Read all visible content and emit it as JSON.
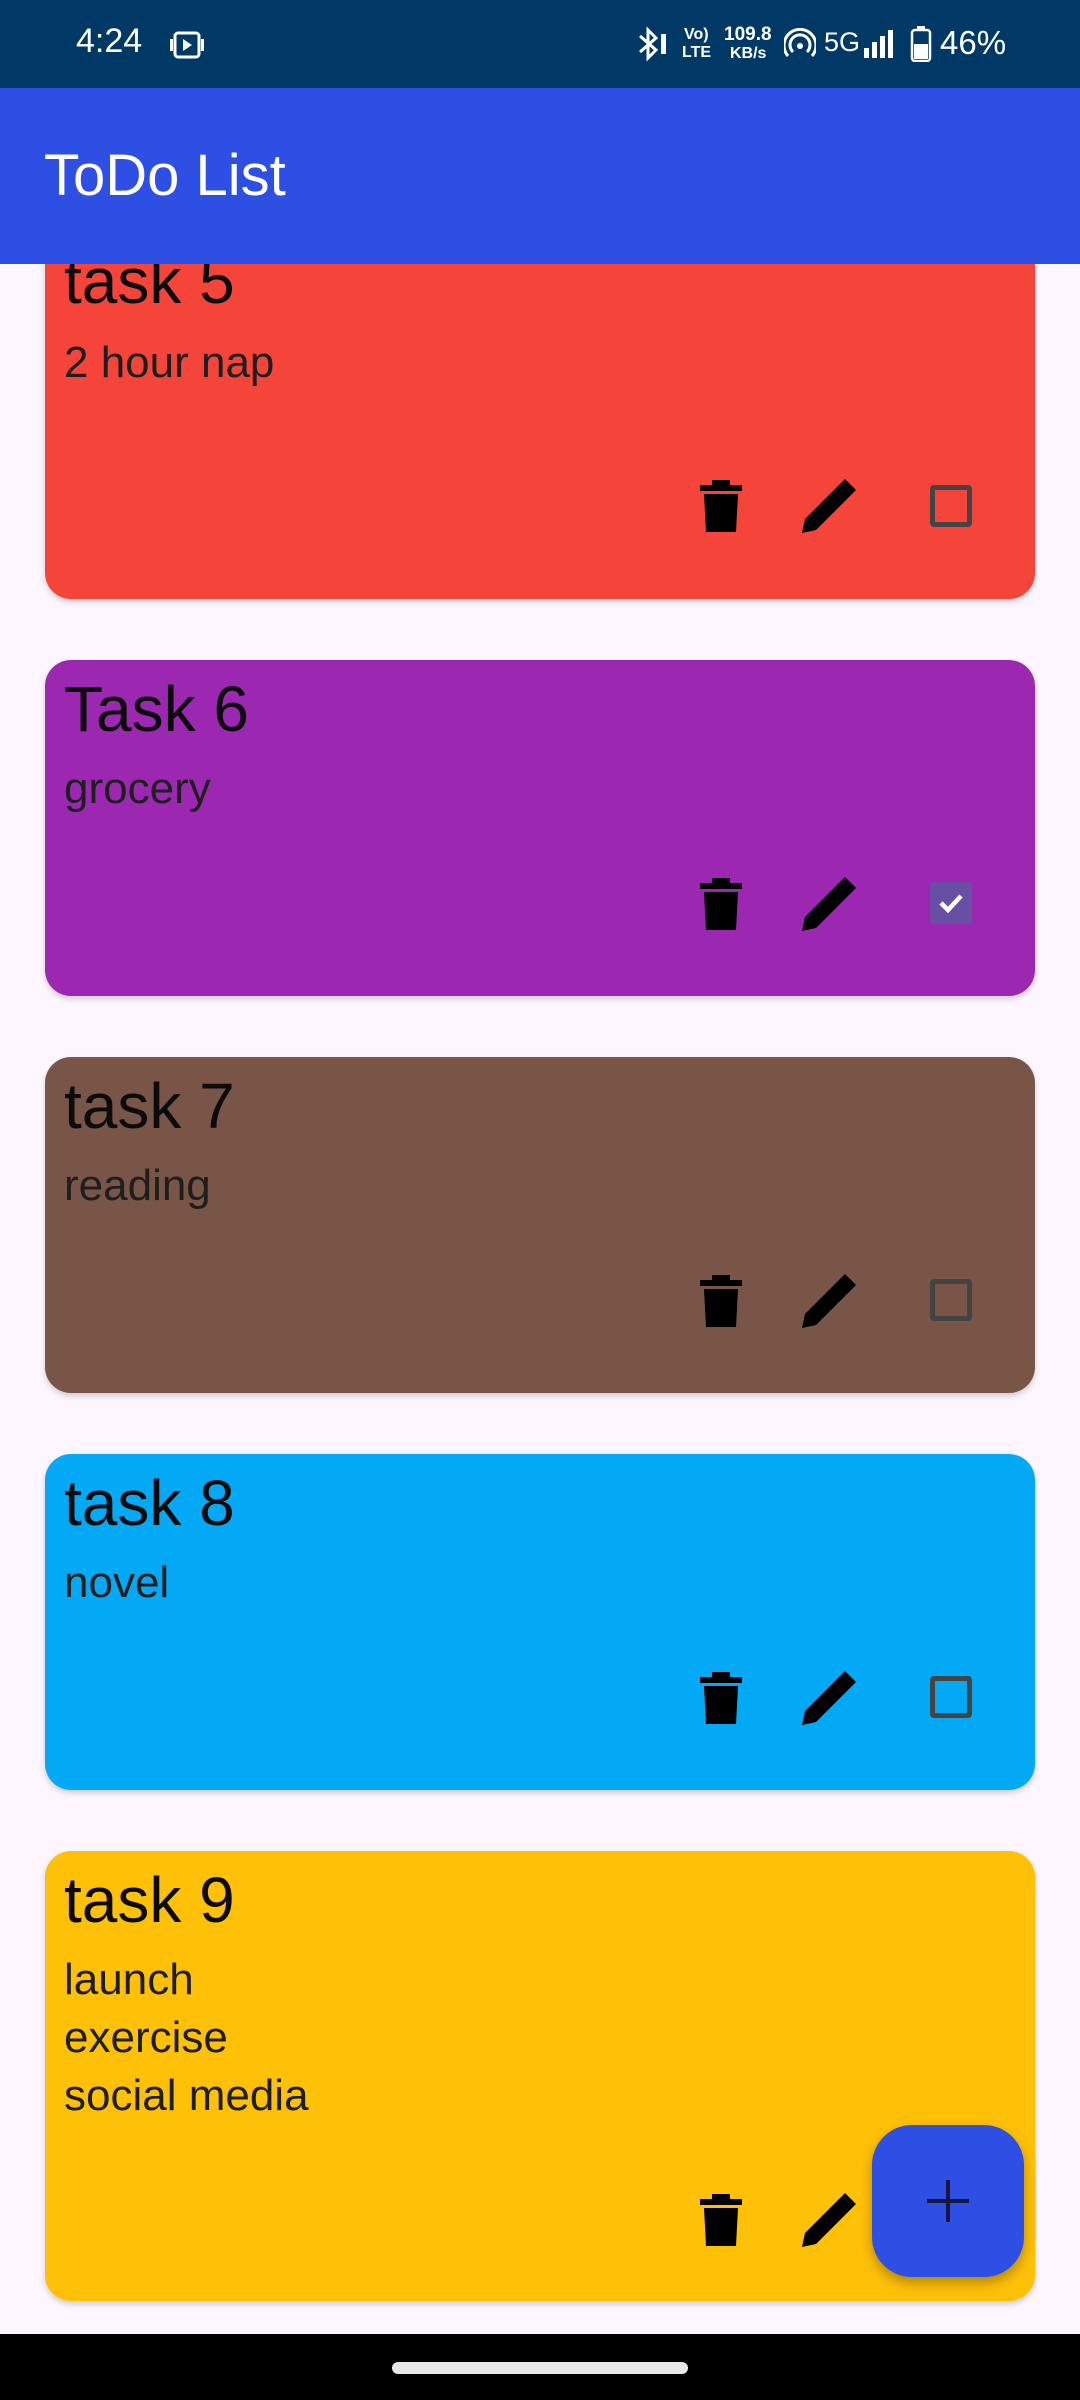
{
  "status_bar": {
    "time": "4:24",
    "net_top": "Vo)",
    "net_bottom": "LTE",
    "speed_value": "109.8",
    "speed_unit": "KB/s",
    "network": "5G",
    "battery": "46%"
  },
  "app_bar": {
    "title": "ToDo List"
  },
  "tasks": [
    {
      "title": "task 5",
      "description": " 2 hour nap",
      "color": "#f5453a",
      "done": false
    },
    {
      "title": "Task 6",
      "description": "grocery",
      "color": "#9c28b1",
      "done": true
    },
    {
      "title": "task 7",
      "description": "reading",
      "color": "#795548",
      "done": false
    },
    {
      "title": "task 8",
      "description": "novel",
      "color": "#03a9f4",
      "done": false
    },
    {
      "title": "task 9",
      "description": "launch\nexercise\nsocial media",
      "color": "#ffc107",
      "done": false
    }
  ],
  "icons": {
    "delete": "trash-icon",
    "edit": "pencil-icon",
    "add": "plus-icon"
  },
  "colors": {
    "status_bar": "#003966",
    "app_bar": "#2e4fe3",
    "fab": "#2e4fe3",
    "background": "#fdf6fe",
    "checkbox_checked": "#6750a4"
  }
}
